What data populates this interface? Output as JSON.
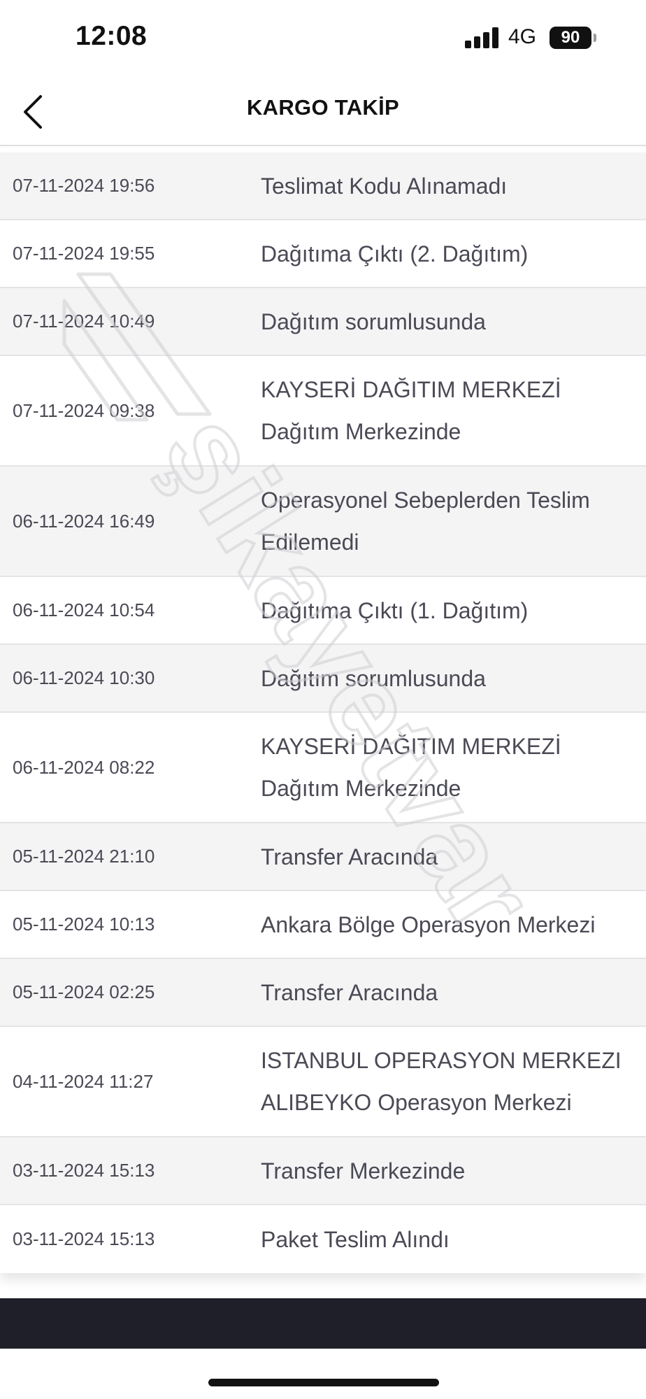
{
  "status_bar": {
    "time": "12:08",
    "network": "4G",
    "battery": "90",
    "signal_icon": "signal-bars-icon",
    "battery_icon": "battery-icon"
  },
  "header": {
    "title": "KARGO TAKİP",
    "back_icon": "chevron-left-icon"
  },
  "history": [
    {
      "date": "07-11-2024 19:56",
      "status": [
        "Teslimat Kodu Alınamadı"
      ]
    },
    {
      "date": "07-11-2024 19:55",
      "status": [
        "Dağıtıma Çıktı (2. Dağıtım)"
      ]
    },
    {
      "date": "07-11-2024 10:49",
      "status": [
        "Dağıtım sorumlusunda"
      ]
    },
    {
      "date": "07-11-2024 09:38",
      "status": [
        "KAYSERİ DAĞITIM MERKEZİ",
        "Dağıtım Merkezinde"
      ]
    },
    {
      "date": "06-11-2024 16:49",
      "status": [
        "Operasyonel Sebeplerden Teslim",
        "Edilemedi"
      ]
    },
    {
      "date": "06-11-2024 10:54",
      "status": [
        "Dağıtıma Çıktı (1. Dağıtım)"
      ]
    },
    {
      "date": "06-11-2024 10:30",
      "status": [
        "Dağıtım sorumlusunda"
      ]
    },
    {
      "date": "06-11-2024 08:22",
      "status": [
        "KAYSERİ DAĞITIM MERKEZİ",
        "Dağıtım Merkezinde"
      ]
    },
    {
      "date": "05-11-2024 21:10",
      "status": [
        "Transfer Aracında"
      ]
    },
    {
      "date": "05-11-2024 10:13",
      "status": [
        "Ankara Bölge Operasyon Merkezi"
      ]
    },
    {
      "date": "05-11-2024 02:25",
      "status": [
        "Transfer Aracında"
      ]
    },
    {
      "date": "04-11-2024 11:27",
      "status": [
        "ISTANBUL OPERASYON MERKEZI",
        "ALIBEYKO Operasyon Merkezi"
      ]
    },
    {
      "date": "03-11-2024 15:13",
      "status": [
        "Transfer Merkezinde"
      ]
    },
    {
      "date": "03-11-2024 15:13",
      "status": [
        "Paket Teslim Alındı"
      ]
    }
  ],
  "watermark": {
    "text": "şikayetvar",
    "icon": "sikayetvar-watermark-logo"
  },
  "colors": {
    "row_alt": "#f4f4f5",
    "row_base": "#ffffff",
    "text": "#4a4a55",
    "bottom_bar": "#1f1f2a"
  }
}
